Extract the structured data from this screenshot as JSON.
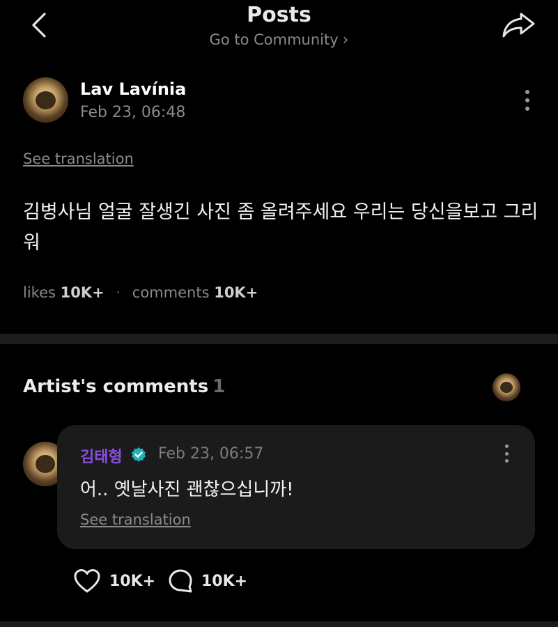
{
  "header": {
    "title": "Posts",
    "community_link": "Go to Community",
    "back_icon": "chevron-left-icon",
    "share_icon": "share-icon"
  },
  "post": {
    "author": "Lav Lavínia",
    "date": "Feb 23, 06:48",
    "see_translation": "See translation",
    "body": "김병사님 얼굴 잘생긴 사진 좀 올려주세요 우리는 당신을보고 그리워",
    "likes_label": "likes",
    "likes_count": "10K+",
    "comments_label": "comments",
    "comments_count": "10K+"
  },
  "artist_comments": {
    "title": "Artist's comments",
    "count": "1",
    "comment": {
      "author": "김태형",
      "verified": true,
      "date": "Feb 23, 06:57",
      "text": "어.. 옛날사진 괜찮으십니까!",
      "see_translation": "See translation",
      "like_count": "10K+",
      "reply_count": "10K+"
    }
  },
  "colors": {
    "background": "#000000",
    "artist_name": "#8a4fe0",
    "verified_badge": "#1fb3b8",
    "card": "#1b1b1b",
    "muted_text": "#8a8a8a"
  }
}
